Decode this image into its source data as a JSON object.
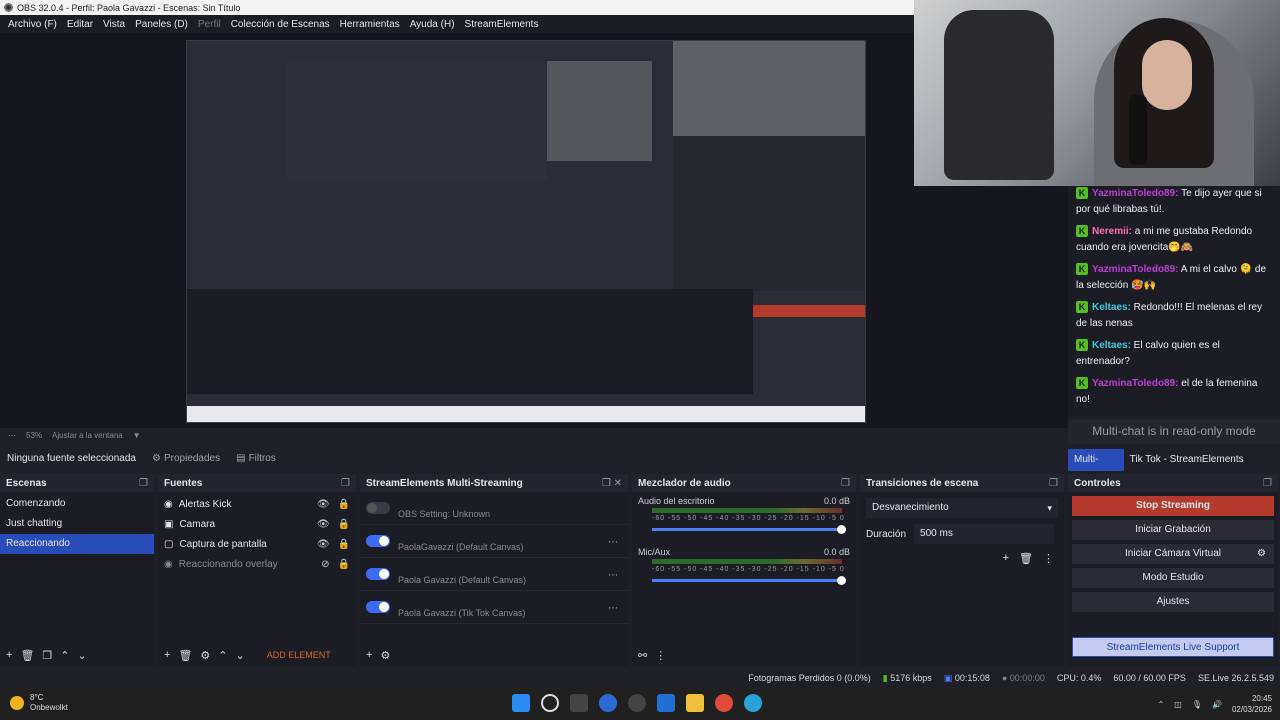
{
  "window": {
    "title": "OBS 32.0.4 - Perfil: Paola Gavazzi - Escenas: Sin Título"
  },
  "menu": [
    "Archivo (F)",
    "Editar",
    "Vista",
    "Paneles (D)",
    "Perfil",
    "Colección de Escenas",
    "Herramientas",
    "Ayuda (H)",
    "StreamElements"
  ],
  "zoom": {
    "value": "53%",
    "fit": "Ajustar a la ventana"
  },
  "props": {
    "none": "Ninguna fuente seleccionada",
    "properties": "Propiedades",
    "filters": "Filtros"
  },
  "chat": {
    "messages": [
      {
        "user": "YazminaToledo89:",
        "color": "#c13dd6",
        "text": " Te dijo ayer que si por qué librabas tú!."
      },
      {
        "user": "Neremii:",
        "color": "#ff6fb0",
        "text": " a mi me gustaba Redondo cuando era jovencita🤭🙈"
      },
      {
        "user": "YazminaToledo89:",
        "color": "#c13dd6",
        "text": " A mi el calvo 🫠 de la selección 🥵🙌"
      },
      {
        "user": "Keltaes:",
        "color": "#3ccbe0",
        "text": " Redondo!!! El melenas el rey de las nenas"
      },
      {
        "user": "Keltaes:",
        "color": "#3ccbe0",
        "text": " El calvo quien es el entrenador?"
      },
      {
        "user": "YazminaToledo89:",
        "color": "#c13dd6",
        "text": " el de la femenina no!"
      }
    ],
    "readonly": "Multi-chat is in read-only mode",
    "tabs": [
      "Multi-Chat",
      "Tik Tok - StreamElements Canvas"
    ]
  },
  "scenes": {
    "title": "Escenas",
    "items": [
      "Comenzando",
      "Just chatting",
      "Reaccionando"
    ],
    "selected": 2
  },
  "sources": {
    "title": "Fuentes",
    "items": [
      "Alertas Kick",
      "Camara",
      "Captura de pantalla",
      "Reaccionando overlay"
    ],
    "add": "ADD ELEMENT"
  },
  "multistream": {
    "title": "StreamElements Multi-Streaming",
    "rows": [
      "OBS Setting: Unknown",
      "PaolaGavazzi (Default Canvas)",
      "Paola Gavazzi (Default Canvas)",
      "Paola Gavazzi (Tik Tok Canvas)"
    ]
  },
  "mixer": {
    "title": "Mezclador de audio",
    "channels": [
      {
        "name": "Audio del escritorio",
        "db": "0.0 dB"
      },
      {
        "name": "Mic/Aux",
        "db": "0.0 dB"
      }
    ],
    "ticks": "-60 -55 -50 -45 -40 -35 -30 -25 -20 -15 -10 -5 0"
  },
  "transitions": {
    "title": "Transiciones de escena",
    "type": "Desvanecimiento",
    "duration_label": "Duración",
    "duration": "500 ms"
  },
  "controls": {
    "title": "Controles",
    "stop": "Stop Streaming",
    "record": "Iniciar Grabación",
    "vcam": "Iniciar Cámara Virtual",
    "studio": "Modo Estudio",
    "settings": "Ajustes",
    "support": "StreamElements Live Support"
  },
  "status": {
    "dropped": "Fotogramas Perdidos 0 (0.0%)",
    "bitrate": "5176 kbps",
    "live": "00:15:08",
    "rec": "00:00:00",
    "cpu": "CPU: 0.4%",
    "fps": "60.00 / 60.00 FPS",
    "version": "SE.Live 26.2.5.549"
  },
  "taskbar": {
    "temp": "8°C",
    "weather": "Onbewolkt",
    "time": "20:45",
    "date": "02/03/2026"
  }
}
